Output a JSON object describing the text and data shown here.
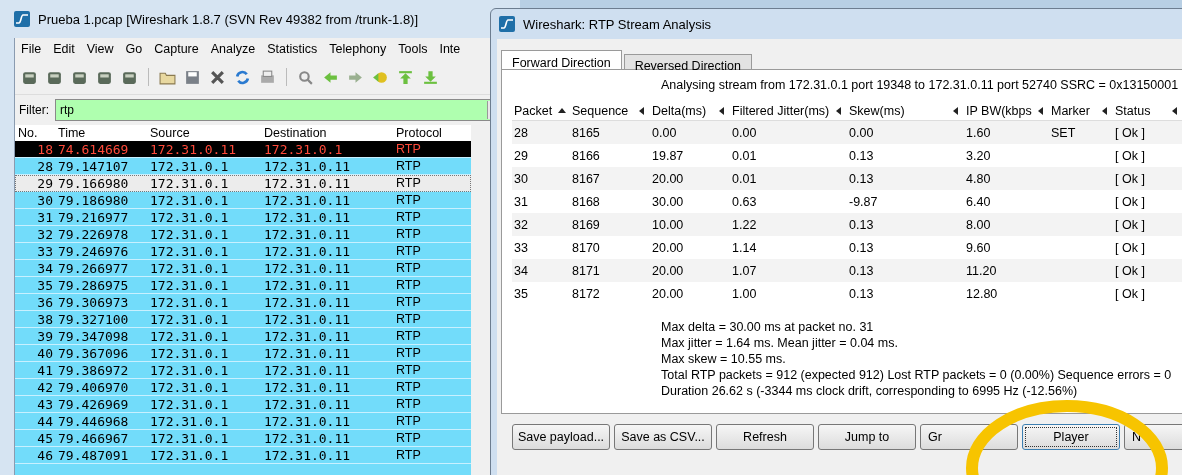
{
  "main_window": {
    "title": "Prueba 1.pcap   [Wireshark 1.8.7  (SVN Rev 49382 from /trunk-1.8)]",
    "menu": [
      "File",
      "Edit",
      "View",
      "Go",
      "Capture",
      "Analyze",
      "Statistics",
      "Telephony",
      "Tools",
      "Inte"
    ],
    "filter": {
      "label": "Filter:",
      "value": "rtp"
    },
    "packet_list": {
      "columns": [
        "No.",
        "Time",
        "Source",
        "Destination",
        "Protocol"
      ],
      "rows": [
        {
          "no": "18",
          "time": "74.614669",
          "source": "172.31.0.11",
          "destination": "172.31.0.1",
          "protocol": "RTP",
          "marked": true,
          "selected": false
        },
        {
          "no": "28",
          "time": "79.147107",
          "source": "172.31.0.1",
          "destination": "172.31.0.11",
          "protocol": "RTP",
          "marked": false,
          "selected": false
        },
        {
          "no": "29",
          "time": "79.166980",
          "source": "172.31.0.1",
          "destination": "172.31.0.11",
          "protocol": "RTP",
          "marked": false,
          "selected": true
        },
        {
          "no": "30",
          "time": "79.186980",
          "source": "172.31.0.1",
          "destination": "172.31.0.11",
          "protocol": "RTP",
          "marked": false,
          "selected": false
        },
        {
          "no": "31",
          "time": "79.216977",
          "source": "172.31.0.1",
          "destination": "172.31.0.11",
          "protocol": "RTP",
          "marked": false,
          "selected": false
        },
        {
          "no": "32",
          "time": "79.226978",
          "source": "172.31.0.1",
          "destination": "172.31.0.11",
          "protocol": "RTP",
          "marked": false,
          "selected": false
        },
        {
          "no": "33",
          "time": "79.246976",
          "source": "172.31.0.1",
          "destination": "172.31.0.11",
          "protocol": "RTP",
          "marked": false,
          "selected": false
        },
        {
          "no": "34",
          "time": "79.266977",
          "source": "172.31.0.1",
          "destination": "172.31.0.11",
          "protocol": "RTP",
          "marked": false,
          "selected": false
        },
        {
          "no": "35",
          "time": "79.286975",
          "source": "172.31.0.1",
          "destination": "172.31.0.11",
          "protocol": "RTP",
          "marked": false,
          "selected": false
        },
        {
          "no": "36",
          "time": "79.306973",
          "source": "172.31.0.1",
          "destination": "172.31.0.11",
          "protocol": "RTP",
          "marked": false,
          "selected": false
        },
        {
          "no": "38",
          "time": "79.327100",
          "source": "172.31.0.1",
          "destination": "172.31.0.11",
          "protocol": "RTP",
          "marked": false,
          "selected": false
        },
        {
          "no": "39",
          "time": "79.347098",
          "source": "172.31.0.1",
          "destination": "172.31.0.11",
          "protocol": "RTP",
          "marked": false,
          "selected": false
        },
        {
          "no": "40",
          "time": "79.367096",
          "source": "172.31.0.1",
          "destination": "172.31.0.11",
          "protocol": "RTP",
          "marked": false,
          "selected": false
        },
        {
          "no": "41",
          "time": "79.386972",
          "source": "172.31.0.1",
          "destination": "172.31.0.11",
          "protocol": "RTP",
          "marked": false,
          "selected": false
        },
        {
          "no": "42",
          "time": "79.406970",
          "source": "172.31.0.1",
          "destination": "172.31.0.11",
          "protocol": "RTP",
          "marked": false,
          "selected": false
        },
        {
          "no": "43",
          "time": "79.426969",
          "source": "172.31.0.1",
          "destination": "172.31.0.11",
          "protocol": "RTP",
          "marked": false,
          "selected": false
        },
        {
          "no": "44",
          "time": "79.446968",
          "source": "172.31.0.1",
          "destination": "172.31.0.11",
          "protocol": "RTP",
          "marked": false,
          "selected": false
        },
        {
          "no": "45",
          "time": "79.466967",
          "source": "172.31.0.1",
          "destination": "172.31.0.11",
          "protocol": "RTP",
          "marked": false,
          "selected": false
        },
        {
          "no": "46",
          "time": "79.487091",
          "source": "172.31.0.1",
          "destination": "172.31.0.11",
          "protocol": "RTP",
          "marked": false,
          "selected": false
        }
      ]
    }
  },
  "dialog": {
    "title": "Wireshark: RTP Stream Analysis",
    "tabs": [
      {
        "label": "Forward Direction",
        "selected": true
      },
      {
        "label": "Reversed Direction",
        "selected": false
      }
    ],
    "stream_info": "Analysing stream from  172.31.0.1 port 19348  to  172.31.0.11 port 52740   SSRC = 0x13150001",
    "table": {
      "columns": [
        {
          "label": "Packet",
          "sorted": true
        },
        {
          "label": "Sequence",
          "sorted": false
        },
        {
          "label": "Delta(ms)",
          "sorted": false
        },
        {
          "label": "Filtered Jitter(ms)",
          "sorted": false
        },
        {
          "label": "Skew(ms)",
          "sorted": false
        },
        {
          "label": "IP BW(kbps",
          "sorted": false
        },
        {
          "label": "Marker",
          "sorted": false
        },
        {
          "label": "Status",
          "sorted": false
        }
      ],
      "rows": [
        [
          "28",
          "8165",
          "0.00",
          "0.00",
          "0.00",
          "1.60",
          "SET",
          "[ Ok ]"
        ],
        [
          "29",
          "8166",
          "19.87",
          "0.01",
          "0.13",
          "3.20",
          "",
          "[ Ok ]"
        ],
        [
          "30",
          "8167",
          "20.00",
          "0.01",
          "0.13",
          "4.80",
          "",
          "[ Ok ]"
        ],
        [
          "31",
          "8168",
          "30.00",
          "0.63",
          "-9.87",
          "6.40",
          "",
          "[ Ok ]"
        ],
        [
          "32",
          "8169",
          "10.00",
          "1.22",
          "0.13",
          "8.00",
          "",
          "[ Ok ]"
        ],
        [
          "33",
          "8170",
          "20.00",
          "1.14",
          "0.13",
          "9.60",
          "",
          "[ Ok ]"
        ],
        [
          "34",
          "8171",
          "20.00",
          "1.07",
          "0.13",
          "11.20",
          "",
          "[ Ok ]"
        ],
        [
          "35",
          "8172",
          "20.00",
          "1.00",
          "0.13",
          "12.80",
          "",
          "[ Ok ]"
        ]
      ]
    },
    "summary": [
      "Max delta = 30.00 ms at packet no. 31",
      "Max jitter = 1.64 ms. Mean jitter = 0.04 ms.",
      "Max skew = 10.55 ms.",
      "Total RTP packets = 912   (expected 912)   Lost RTP packets = 0 (0.00%)   Sequence errors = 0",
      "Duration 26.62 s (-3344 ms clock drift, corresponding to 6995 Hz (-12.56%)"
    ],
    "buttons": [
      {
        "label": "Save payload...",
        "focused": false,
        "covered": false
      },
      {
        "label": "Save as CSV...",
        "focused": false,
        "covered": false
      },
      {
        "label": "Refresh",
        "focused": false,
        "covered": false
      },
      {
        "label": "Jump to",
        "focused": false,
        "covered": false
      },
      {
        "label": "Gr",
        "focused": false,
        "covered": true
      },
      {
        "label": "Player",
        "focused": true,
        "covered": false
      },
      {
        "label": "N",
        "focused": false,
        "covered": true
      }
    ]
  }
}
